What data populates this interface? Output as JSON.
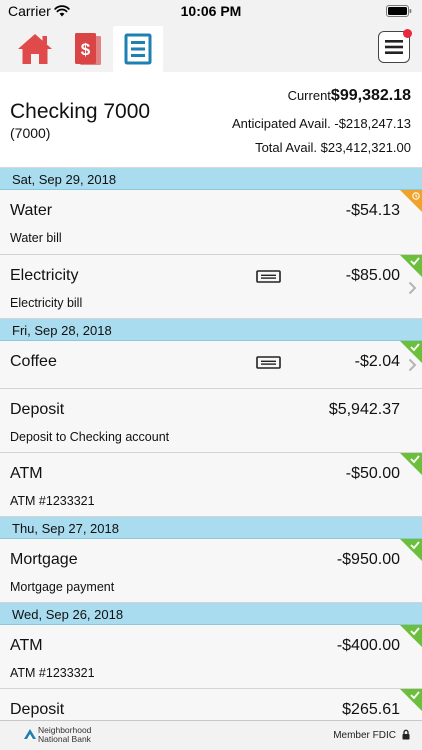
{
  "status_bar": {
    "carrier": "Carrier",
    "time": "10:06 PM"
  },
  "nav": {
    "tabs": [
      {
        "name": "home",
        "icon": "home-icon",
        "color": "#e04a4a"
      },
      {
        "name": "bill-pay",
        "icon": "bill-pay-icon",
        "color": "#d94545"
      },
      {
        "name": "accounts",
        "icon": "accounts-icon",
        "color": "#1e7fb2",
        "active": true
      }
    ],
    "menu_icon": "hamburger-menu-icon",
    "badge_color": "#e8283b"
  },
  "account": {
    "name": "Checking 7000",
    "number": "(7000)",
    "current_label": "Current",
    "current_amount": "$99,382.18",
    "anticipated_label": "Anticipated Avail.",
    "anticipated_amount": "-$218,247.13",
    "total_label": "Total Avail.",
    "total_amount": "$23,412,321.00"
  },
  "colors": {
    "date_header": "#a9dcef",
    "cleared": "#6cbf3c",
    "pending": "#f0a22a"
  },
  "groups": [
    {
      "date": "Sat, Sep 29, 2018",
      "transactions": [
        {
          "name": "Water",
          "desc": "Water bill",
          "amount": "-$54.13",
          "status": "pending"
        },
        {
          "name": "Electricity",
          "desc": "Electricity bill",
          "amount": "-$85.00",
          "status": "cleared",
          "memo": true,
          "chevron": true
        }
      ]
    },
    {
      "date": "Fri, Sep 28, 2018",
      "transactions": [
        {
          "name": "Coffee",
          "desc": "",
          "amount": "-$2.04",
          "status": "cleared",
          "memo": true,
          "chevron": true
        },
        {
          "name": "Deposit",
          "desc": "Deposit to Checking account",
          "amount": "$5,942.37",
          "status": "none"
        },
        {
          "name": "ATM",
          "desc": "ATM #1233321",
          "amount": "-$50.00",
          "status": "cleared"
        }
      ]
    },
    {
      "date": "Thu, Sep 27, 2018",
      "transactions": [
        {
          "name": "Mortgage",
          "desc": "Mortgage payment",
          "amount": "-$950.00",
          "status": "cleared"
        }
      ]
    },
    {
      "date": "Wed, Sep 26, 2018",
      "transactions": [
        {
          "name": "ATM",
          "desc": "ATM #1233321",
          "amount": "-$400.00",
          "status": "cleared"
        },
        {
          "name": "Deposit",
          "desc": "",
          "amount": "$265.61",
          "status": "cleared"
        }
      ]
    }
  ],
  "footer": {
    "bank_name_line1": "Neighborhood",
    "bank_name_line2": "National Bank",
    "fdic": "Member FDIC",
    "lock_icon": "lock-icon"
  }
}
